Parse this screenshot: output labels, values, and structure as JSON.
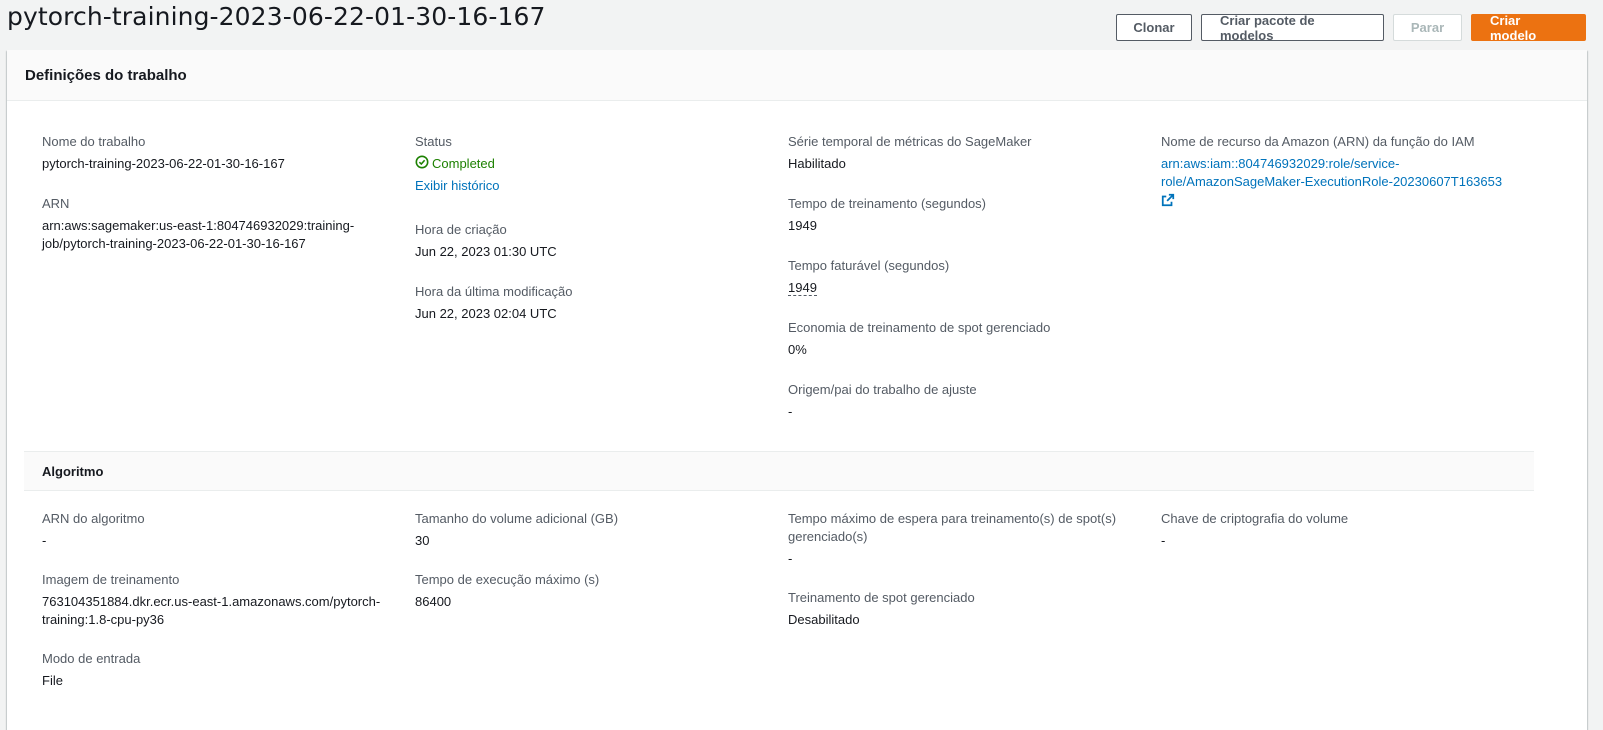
{
  "page": {
    "title": "pytorch-training-2023-06-22-01-30-16-167"
  },
  "actions": {
    "clone": "Clonar",
    "create_package": "Criar pacote de modelos",
    "stop": "Parar",
    "create_model": "Criar modelo"
  },
  "colors": {
    "primary": "#ec7211",
    "link": "#0073bb",
    "success": "#1d8102"
  },
  "settings": {
    "header": "Definições do trabalho",
    "job_name": {
      "label": "Nome do trabalho",
      "value": "pytorch-training-2023-06-22-01-30-16-167"
    },
    "arn": {
      "label": "ARN",
      "value": "arn:aws:sagemaker:us-east-1:804746932029:training-job/pytorch-training-2023-06-22-01-30-16-167"
    },
    "status": {
      "label": "Status",
      "value": "Completed",
      "icon": "check-circle-icon",
      "history_link": "Exibir histórico"
    },
    "created": {
      "label": "Hora de criação",
      "value": "Jun 22, 2023 01:30 UTC"
    },
    "modified": {
      "label": "Hora da última modificação",
      "value": "Jun 22, 2023 02:04 UTC"
    },
    "metrics": {
      "label": "Série temporal de métricas do SageMaker",
      "value": "Habilitado"
    },
    "training_time": {
      "label": "Tempo de treinamento (segundos)",
      "value": "1949"
    },
    "billable_time": {
      "label": "Tempo faturável (segundos)",
      "value": "1949"
    },
    "spot_savings": {
      "label": "Economia de treinamento de spot gerenciado",
      "value": "0%"
    },
    "tuning_origin": {
      "label": "Origem/pai do trabalho de ajuste",
      "value": "-"
    },
    "iam_role": {
      "label": "Nome de recurso da Amazon (ARN) da função do IAM",
      "value": "arn:aws:iam::804746932029:role/service-role/AmazonSageMaker-ExecutionRole-20230607T163653",
      "icon": "external-link-icon"
    }
  },
  "algorithm": {
    "header": "Algoritmo",
    "algorithm_arn": {
      "label": "ARN do algoritmo",
      "value": "-"
    },
    "training_image": {
      "label": "Imagem de treinamento",
      "value": "763104351884.dkr.ecr.us-east-1.amazonaws.com/pytorch-training:1.8-cpu-py36"
    },
    "input_mode": {
      "label": "Modo de entrada",
      "value": "File"
    },
    "volume_size": {
      "label": "Tamanho do volume adicional (GB)",
      "value": "30"
    },
    "max_runtime": {
      "label": "Tempo de execução máximo (s)",
      "value": "86400"
    },
    "max_wait": {
      "label": "Tempo máximo de espera para treinamento(s) de spot(s) gerenciado(s)",
      "value": "-"
    },
    "managed_spot": {
      "label": "Treinamento de spot gerenciado",
      "value": "Desabilitado"
    },
    "volume_key": {
      "label": "Chave de criptografia do volume",
      "value": "-"
    }
  }
}
